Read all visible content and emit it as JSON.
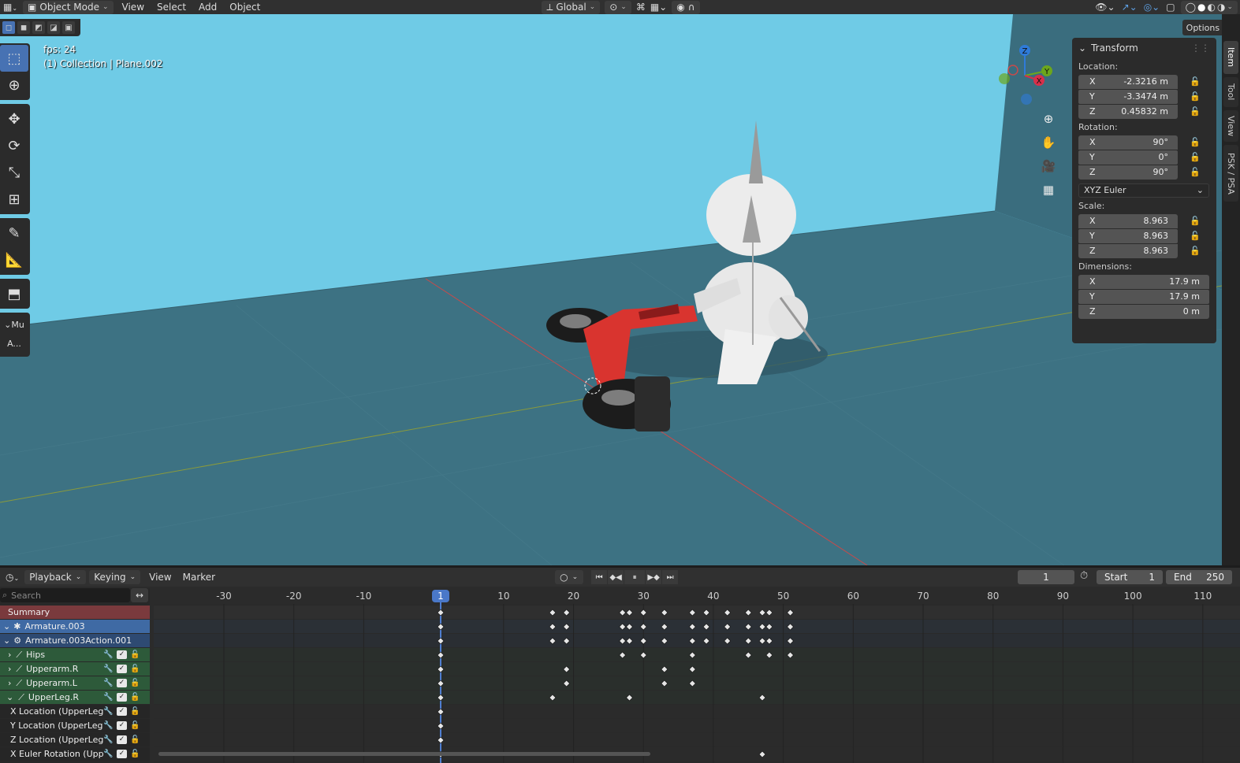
{
  "header": {
    "mode": "Object Mode",
    "menus": [
      "View",
      "Select",
      "Add",
      "Object"
    ],
    "transform_orientation": "Global"
  },
  "viewport": {
    "fps_text": "fps: 24",
    "collection_text": "(1) Collection | Plane.002",
    "options_label": "Options",
    "mini_tool_label": "Mu",
    "mini_tool_button": "A...",
    "gizmo_axes": [
      "Z",
      "Y",
      "X"
    ],
    "colors": {
      "sky": "#6fcbe6",
      "floor": "#3d7283",
      "wall": "#3a6d7e",
      "bike_red": "#d9342f",
      "figure_white": "#ececec"
    }
  },
  "npanel": {
    "title": "Transform",
    "location_label": "Location:",
    "location": [
      {
        "axis": "X",
        "value": "-2.3216 m"
      },
      {
        "axis": "Y",
        "value": "-3.3474 m"
      },
      {
        "axis": "Z",
        "value": "0.45832 m"
      }
    ],
    "rotation_label": "Rotation:",
    "rotation": [
      {
        "axis": "X",
        "value": "90°"
      },
      {
        "axis": "Y",
        "value": "0°"
      },
      {
        "axis": "Z",
        "value": "90°"
      }
    ],
    "rotation_mode": "XYZ Euler",
    "scale_label": "Scale:",
    "scale": [
      {
        "axis": "X",
        "value": "8.963"
      },
      {
        "axis": "Y",
        "value": "8.963"
      },
      {
        "axis": "Z",
        "value": "8.963"
      }
    ],
    "dimensions_label": "Dimensions:",
    "dimensions": [
      {
        "axis": "X",
        "value": "17.9 m"
      },
      {
        "axis": "Y",
        "value": "17.9 m"
      },
      {
        "axis": "Z",
        "value": "0 m"
      }
    ],
    "tabs": [
      "Item",
      "Tool",
      "View",
      "PSK / PSA"
    ]
  },
  "dopesheet": {
    "menus": {
      "playback": "Playback",
      "keying": "Keying",
      "view": "View",
      "marker": "Marker"
    },
    "current_frame": "1",
    "start_label": "Start",
    "start": "1",
    "end_label": "End",
    "end": "250",
    "search_placeholder": "Search",
    "channels": [
      {
        "label": "Summary",
        "type": "summary"
      },
      {
        "label": "Armature.003",
        "type": "object"
      },
      {
        "label": "Armature.003Action.001",
        "type": "action"
      },
      {
        "label": "Hips",
        "type": "group"
      },
      {
        "label": "Upperarm.R",
        "type": "group"
      },
      {
        "label": "Upperarm.L",
        "type": "group"
      },
      {
        "label": "UpperLeg.R",
        "type": "group"
      },
      {
        "label": "X Location (UpperLeg",
        "type": "fcurve"
      },
      {
        "label": "Y Location (UpperLeg",
        "type": "fcurve"
      },
      {
        "label": "Z Location (UpperLeg",
        "type": "fcurve"
      },
      {
        "label": "X Euler Rotation (Upp",
        "type": "fcurve"
      }
    ],
    "ruler_ticks": [
      "-30",
      "-20",
      "-10",
      "10",
      "20",
      "30",
      "40",
      "50",
      "60",
      "70",
      "80",
      "90",
      "100",
      "110"
    ],
    "keyframes": [
      [
        1,
        17,
        19,
        27,
        28,
        30,
        33,
        37,
        39,
        42,
        45,
        47,
        48,
        51
      ],
      [
        1,
        17,
        19,
        27,
        28,
        30,
        33,
        37,
        39,
        42,
        45,
        47,
        48,
        51
      ],
      [
        1,
        17,
        19,
        27,
        28,
        30,
        33,
        37,
        39,
        42,
        45,
        47,
        48,
        51
      ],
      [
        1,
        27,
        30,
        37,
        45,
        48,
        51
      ],
      [
        1,
        19,
        33,
        37
      ],
      [
        1,
        19,
        33,
        37
      ],
      [
        1,
        17,
        28,
        47
      ],
      [
        1
      ],
      [
        1
      ],
      [
        1
      ],
      [
        1,
        47
      ]
    ]
  }
}
